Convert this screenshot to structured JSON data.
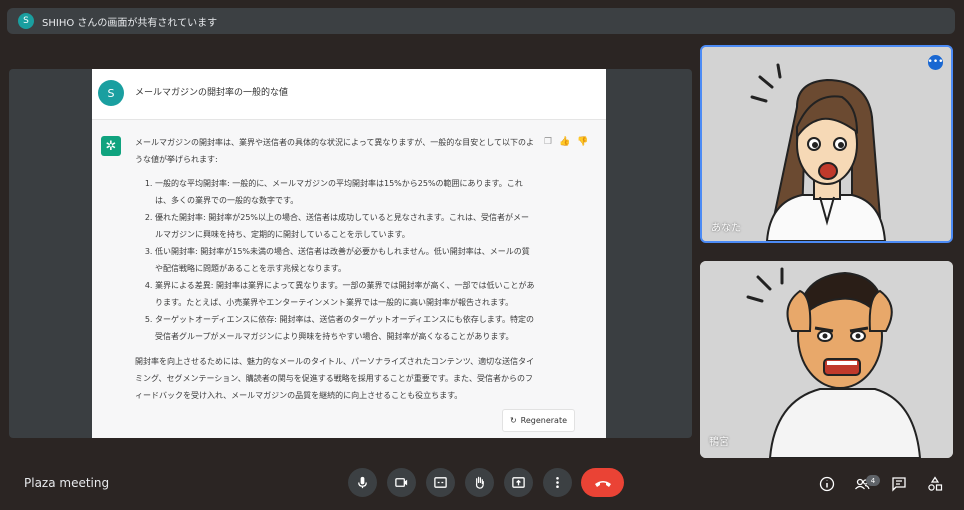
{
  "banner": {
    "icon_letter": "S",
    "text": "SHIHO さんの画面が共有されています"
  },
  "shared": {
    "user_letter": "S",
    "question": "メールマガジンの開封率の一般的な値",
    "answer": {
      "intro": "メールマガジンの開封率は、業界や送信者の具体的な状況によって異なりますが、一般的な目安として以下のような値が挙げられます:",
      "items": [
        "一般的な平均開封率: 一般的に、メールマガジンの平均開封率は15%から25%の範囲にあります。これは、多くの業界での一般的な数字です。",
        "優れた開封率: 開封率が25%以上の場合、送信者は成功していると見なされます。これは、受信者がメールマガジンに興味を持ち、定期的に開封していることを示しています。",
        "低い開封率: 開封率が15%未満の場合、送信者は改善が必要かもしれません。低い開封率は、メールの質や配信戦略に問題があることを示す兆候となります。",
        "業界による差異: 開封率は業界によって異なります。一部の業界では開封率が高く、一部では低いことがあります。たとえば、小売業界やエンターテインメント業界では一般的に高い開封率が報告されます。",
        "ターゲットオーディエンスに依存: 開封率は、送信者のターゲットオーディエンスにも依存します。特定の受信者グループがメールマガジンにより興味を持ちやすい場合、開封率が高くなることがあります。"
      ],
      "conclusion": "開封率を向上させるためには、魅力的なメールのタイトル、パーソナライズされたコンテンツ、適切な送信タイミング、セグメンテーション、購読者の関与を促進する戦略を採用することが重要です。また、受信者からのフィードバックを受け入れ、メールマガジンの品質を継続的に向上させることも役立ちます。"
    },
    "regenerate_label": "Regenerate"
  },
  "participants": [
    {
      "label": "あなた"
    },
    {
      "label": "鴨宮"
    }
  ],
  "bottom": {
    "meeting_name": "Plaza meeting",
    "people_count": "4"
  },
  "colors": {
    "accent": "#4c8bf5",
    "hangup": "#ea4335",
    "teal": "#1a9fa0",
    "gpt": "#10a37f"
  }
}
